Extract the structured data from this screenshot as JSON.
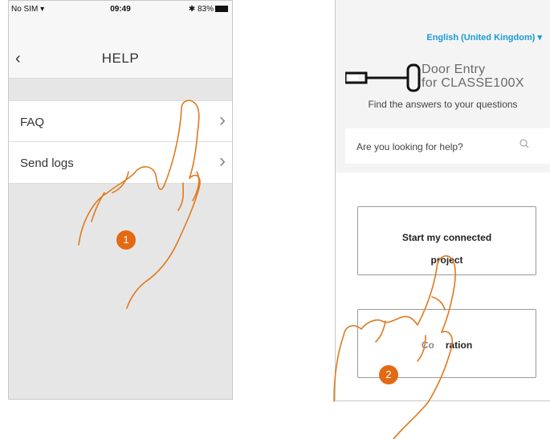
{
  "left_screen": {
    "status": {
      "carrier": "No SIM",
      "time": "09:49",
      "battery": "83%"
    },
    "title": "HELP",
    "items": [
      {
        "label": "FAQ"
      },
      {
        "label": "Send logs"
      }
    ],
    "step": "1"
  },
  "right_screen": {
    "language": "English (United Kingdom)",
    "logo_line1": "Door Entry",
    "logo_line2": "for CLASSE100X",
    "tagline": "Find the answers to your questions",
    "search_placeholder": "Are you looking for help?",
    "button1_line1": "Start my connected",
    "button1_line2": "project",
    "button2_prefix": "Co",
    "button2_suffix": "ration",
    "step": "2"
  },
  "colors": {
    "accent": "#e36a12",
    "link": "#1a9ad6"
  }
}
